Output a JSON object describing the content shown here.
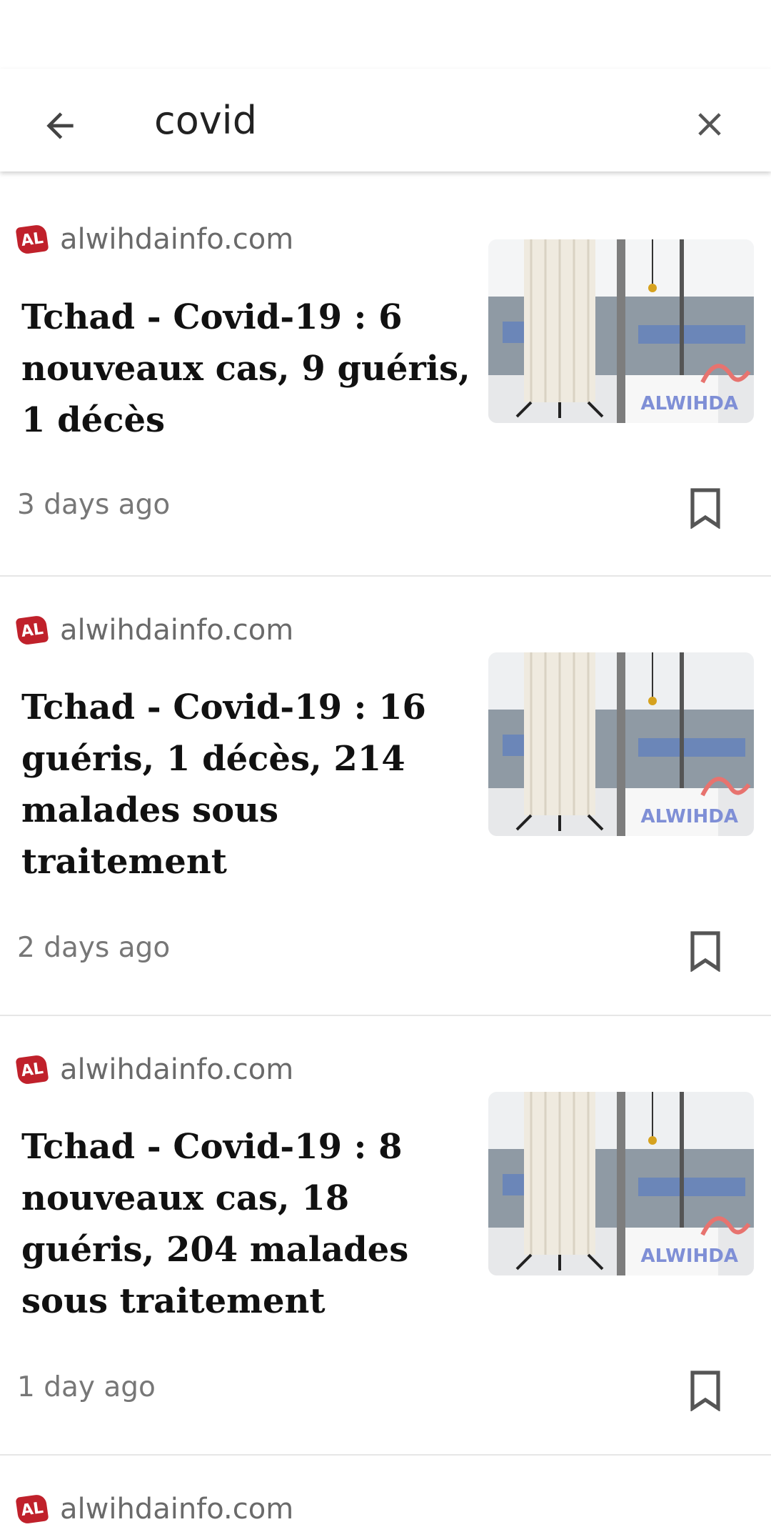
{
  "search": {
    "query": "covid",
    "back_icon": "arrow-left-icon",
    "clear_icon": "close-icon"
  },
  "articles": [
    {
      "source": "alwihdainfo.com",
      "logo_text": "AL",
      "title": "Tchad - Covid-19 : 6 nouveaux cas, 9 guéris, 1 décès",
      "time": "3 days ago",
      "watermark_text": "ALWIHDA"
    },
    {
      "source": "alwihdainfo.com",
      "logo_text": "AL",
      "title": "Tchad - Covid-19 : 16 guéris, 1 décès, 214 malades sous traitement",
      "time": "2 days ago",
      "watermark_text": "ALWIHDA"
    },
    {
      "source": "alwihdainfo.com",
      "logo_text": "AL",
      "title": "Tchad - Covid-19 : 8 nouveaux cas, 18 guéris, 204 malades sous traitement",
      "time": "1 day ago",
      "watermark_text": "ALWIHDA"
    },
    {
      "source": "alwihdainfo.com",
      "logo_text": "AL"
    }
  ],
  "colors": {
    "logo_red": "#c0212b",
    "divider": "#e6e6e6",
    "meta_text": "#777777"
  }
}
